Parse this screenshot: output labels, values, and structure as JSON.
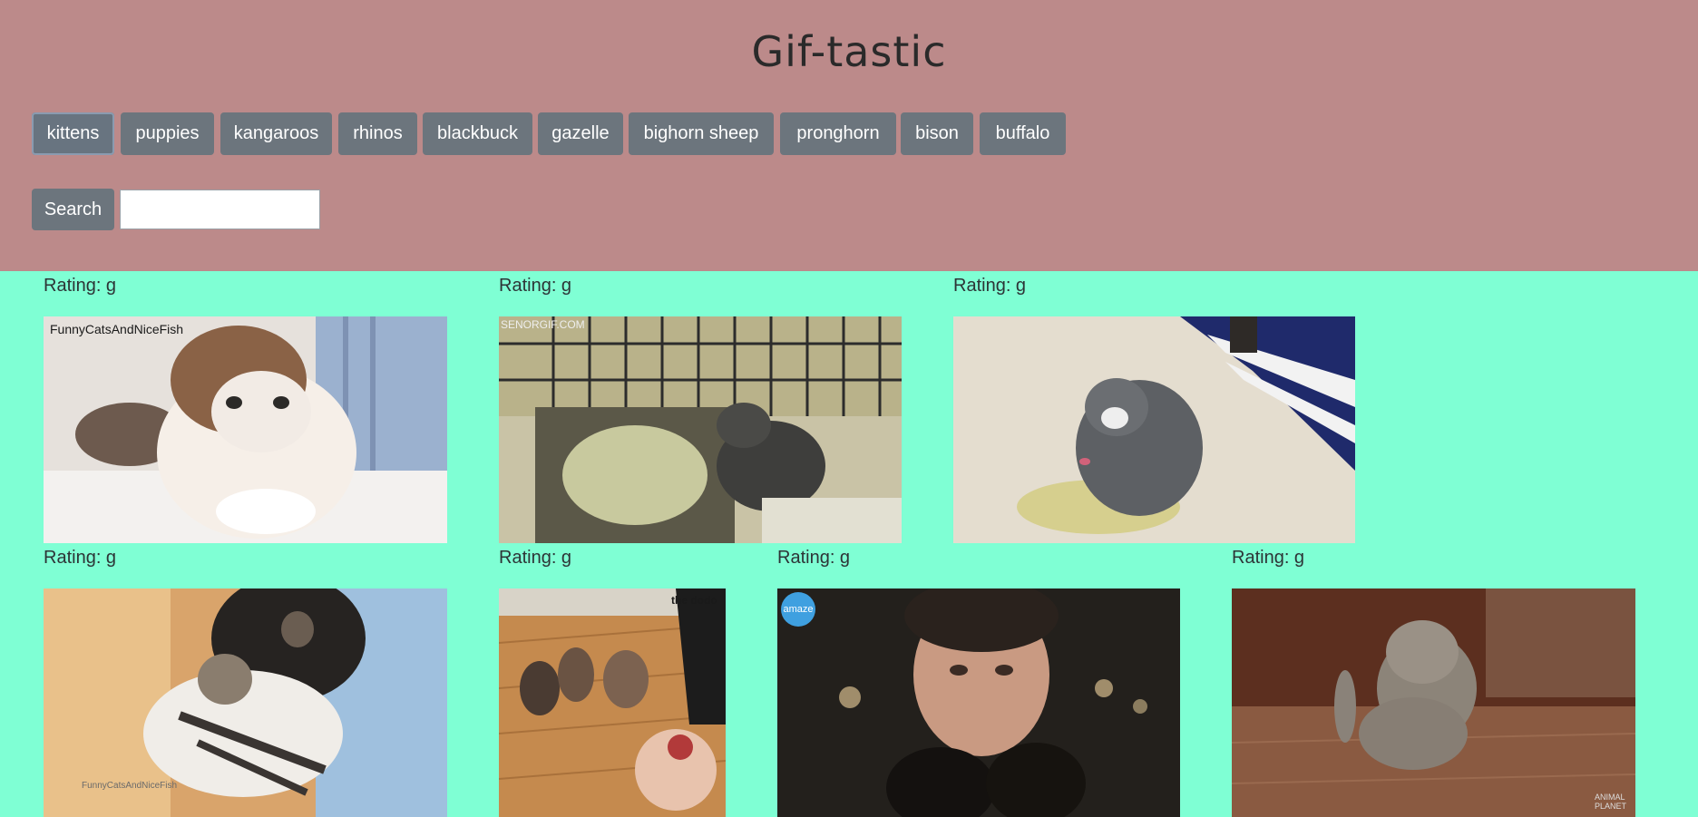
{
  "app": {
    "title": "Gif-tastic"
  },
  "topics": [
    "kittens",
    "puppies",
    "kangaroos",
    "rhinos",
    "blackbuck",
    "gazelle",
    "bighorn sheep",
    "pronghorn",
    "bison",
    "buffalo"
  ],
  "active_topic": "kittens",
  "search": {
    "button_label": "Search",
    "value": "",
    "placeholder": ""
  },
  "results": [
    {
      "rating": "Rating: g",
      "watermark": "FunnyCatsAndNiceFish"
    },
    {
      "rating": "Rating: g",
      "watermark": "SENORGIF.COM"
    },
    {
      "rating": "Rating: g"
    },
    {
      "rating": "Rating: g",
      "watermark": "FunnyCatsAndNiceFish"
    },
    {
      "rating": "Rating: g",
      "watermark": "the dodo"
    },
    {
      "rating": "Rating: g",
      "watermark": "amaze"
    },
    {
      "rating": "Rating: g",
      "watermark": "ANIMAL PLANET"
    }
  ],
  "colors": {
    "header_bg": "#bc8a8a",
    "page_bg": "#7fffd4",
    "button_bg": "#6c757d"
  }
}
